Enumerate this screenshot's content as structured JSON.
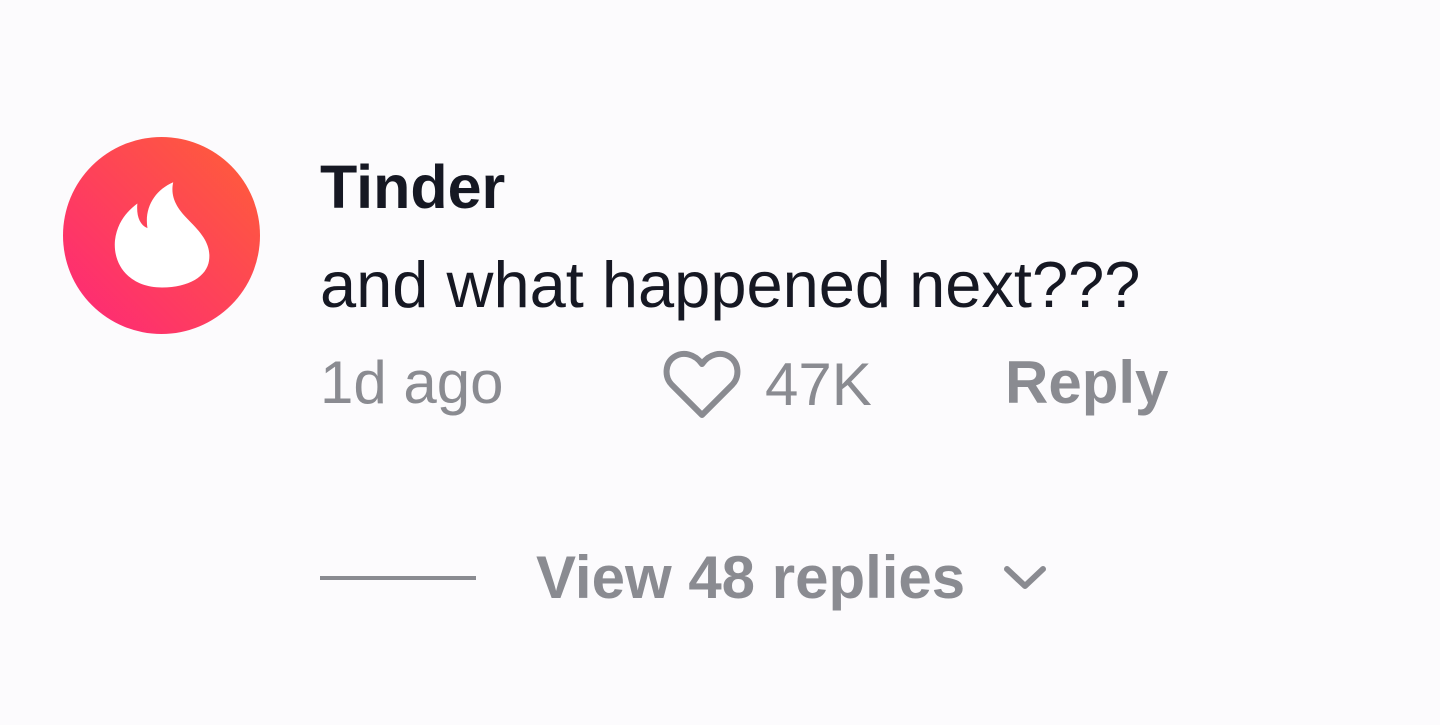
{
  "comment": {
    "username": "Tinder",
    "text": "and what happened next???",
    "timestamp": "1d ago",
    "like_count": "47K",
    "reply_label": "Reply",
    "view_replies_label": "View 48 replies"
  },
  "avatar": {
    "icon": "tinder-flame-icon",
    "gradient_start": "#fd267a",
    "gradient_end": "#ff6036"
  },
  "colors": {
    "background": "#fcfbfd",
    "primary_text": "#161823",
    "secondary_text": "#8a8b91"
  },
  "icons": {
    "like": "heart-outline-icon",
    "expand": "chevron-down-icon"
  }
}
